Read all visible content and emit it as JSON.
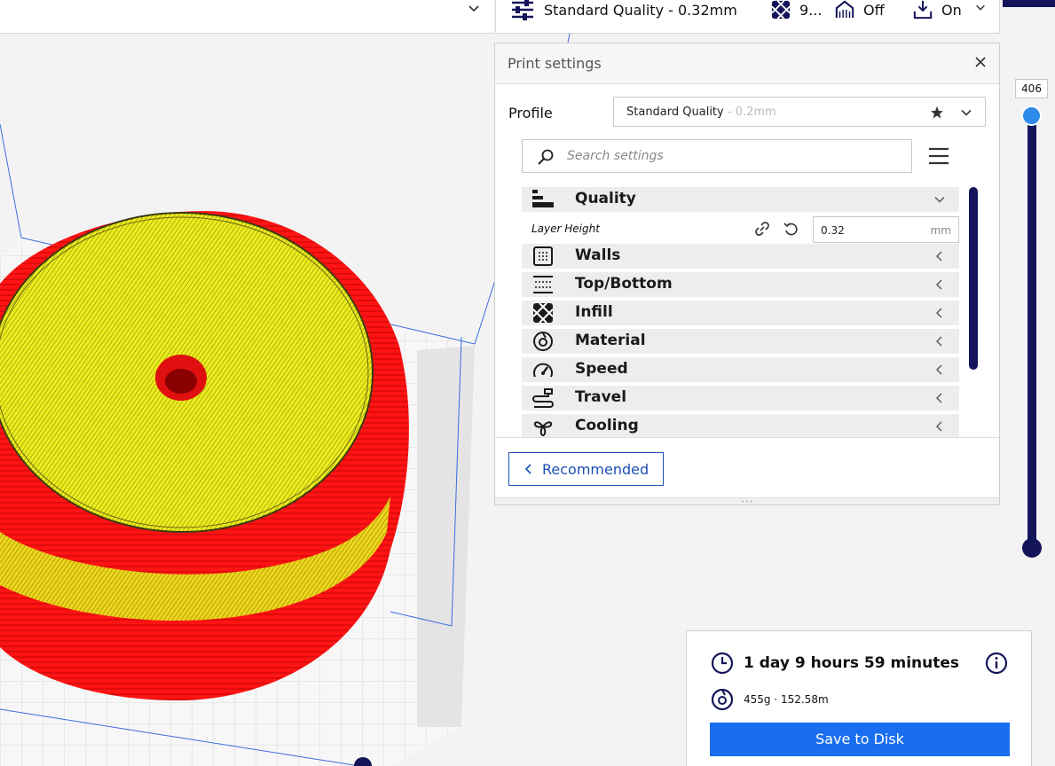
{
  "topbar": {
    "quality_label": "Standard Quality - 0.32mm",
    "infill_value": "9...",
    "support_value": "Off",
    "adhesion_value": "On"
  },
  "panel": {
    "title": "Print settings",
    "profile_label": "Profile",
    "profile_name": "Standard Quality",
    "profile_sub": " - 0.2mm",
    "search_placeholder": "Search settings",
    "categories": [
      {
        "label": "Quality",
        "icon": "quality-icon"
      },
      {
        "label": "Walls",
        "icon": "walls-icon"
      },
      {
        "label": "Top/Bottom",
        "icon": "top-bottom-icon"
      },
      {
        "label": "Infill",
        "icon": "infill-icon"
      },
      {
        "label": "Material",
        "icon": "material-icon"
      },
      {
        "label": "Speed",
        "icon": "speed-icon"
      },
      {
        "label": "Travel",
        "icon": "travel-icon"
      },
      {
        "label": "Cooling",
        "icon": "cooling-icon"
      }
    ],
    "layer_height": {
      "label": "Layer Height",
      "value": "0.32",
      "unit": "mm"
    },
    "recommended_label": "Recommended"
  },
  "layer_slider": {
    "current_layer": "406"
  },
  "print_info": {
    "time": "1 day 9 hours 59 minutes",
    "material": "455g · 152.58m",
    "save_label": "Save to Disk"
  },
  "colors": {
    "accent_blue": "#196ef0",
    "dark_navy": "#14145a",
    "model_red": "#ff1a1a",
    "model_yellow": "#f0f01e"
  }
}
